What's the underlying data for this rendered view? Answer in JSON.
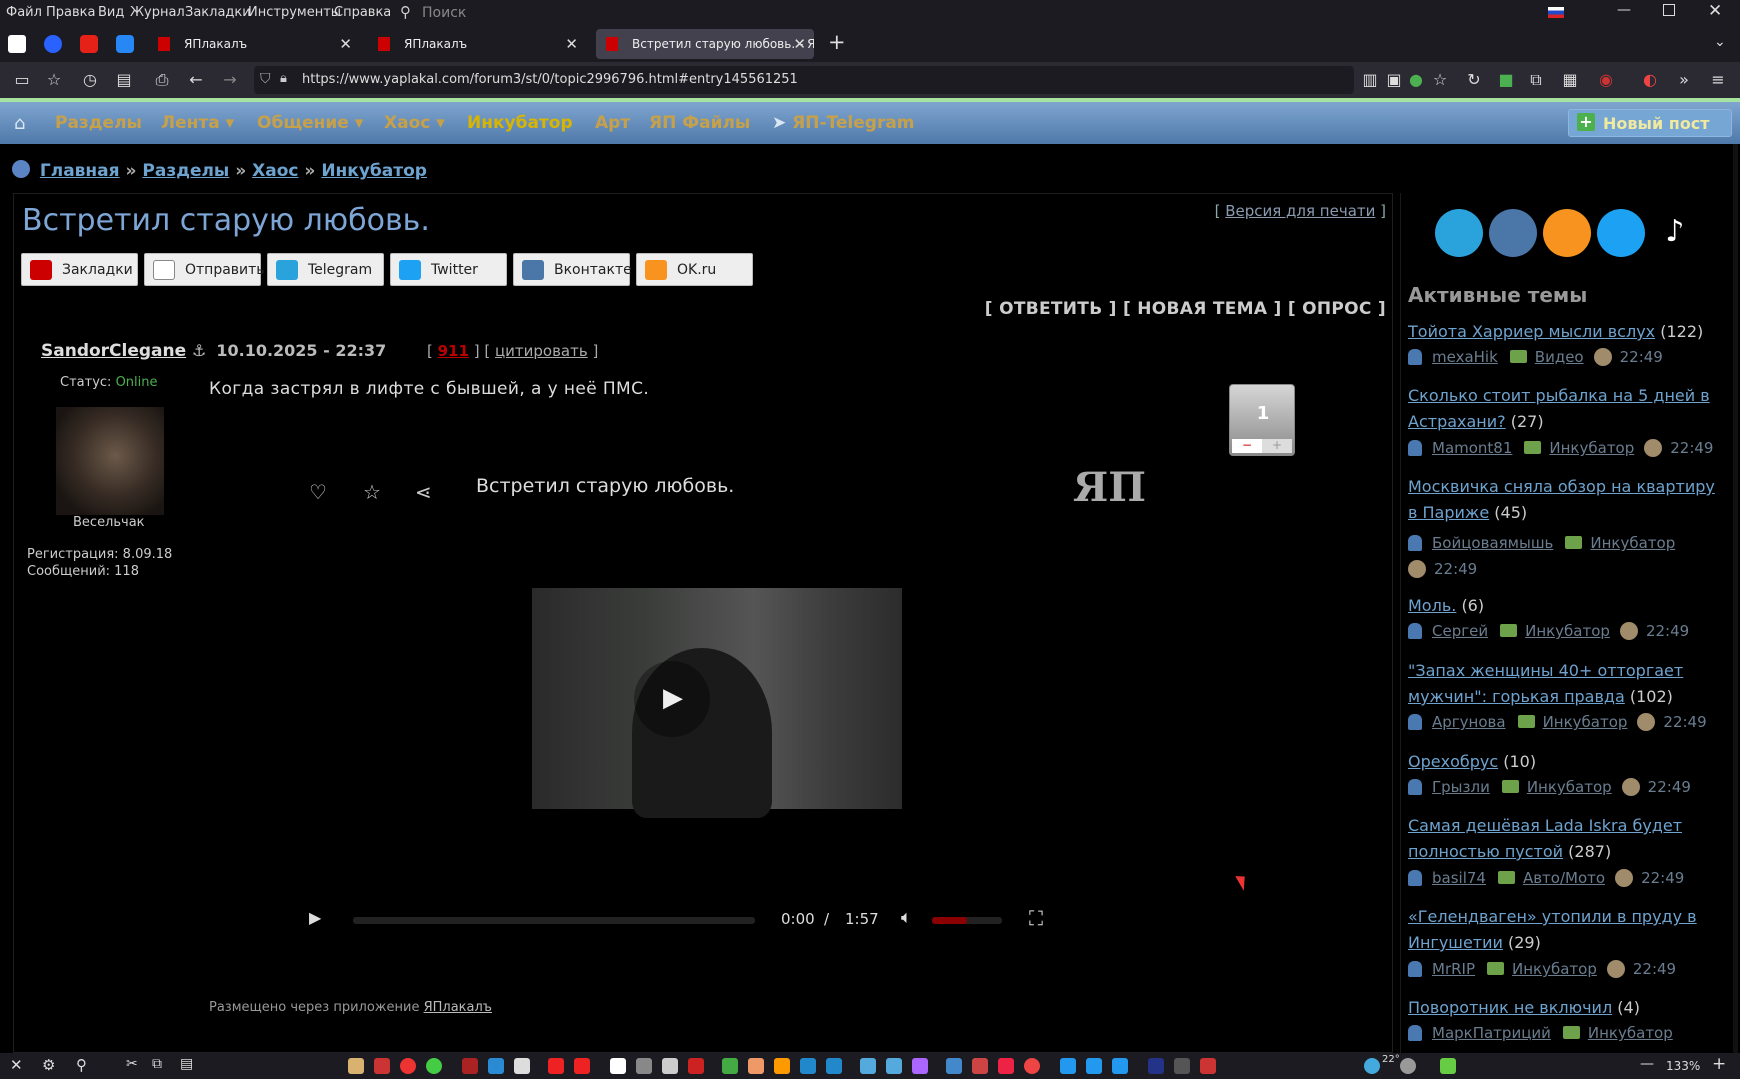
{
  "menubar": {
    "items": [
      "Файл",
      "Правка",
      "Вид",
      "Журнал",
      "Закладки",
      "Инструменты",
      "Справка"
    ],
    "search_placeholder": "Поиск"
  },
  "tabs": [
    {
      "label": "ЯПлакалъ"
    },
    {
      "label": "ЯПлакалъ"
    },
    {
      "label": "Встретил старую любовь. - ЯП"
    }
  ],
  "url": "https://www.yaplakal.com/forum3/st/0/topic2996796.html#entry145561251",
  "sitenav": {
    "items": [
      "Разделы",
      "Лента",
      "Общение",
      "Хаос",
      "Инкубатор",
      "Арт",
      "ЯП Файлы",
      "ЯП-Telegram"
    ],
    "new_post": "Новый пост"
  },
  "breadcrumb": {
    "items": [
      "Главная",
      "Разделы",
      "Хаос",
      "Инкубатор"
    ],
    "sep": "»"
  },
  "topic": {
    "title": "Встретил старую любовь.",
    "print_version": "Версия для печати",
    "share": [
      "Закладки",
      "Отправить",
      "Telegram",
      "Twitter",
      "Вконтакте",
      "OK.ru"
    ],
    "actions": "[ ОТВЕТИТЬ ] [ НОВАЯ ТЕМА ] [ ОПРОС ]"
  },
  "post": {
    "author": "SandorClegane",
    "status_label": "Статус:",
    "status_value": "Online",
    "rank": "Весельчак",
    "registration": "Регистрация: 8.09.18",
    "messages": "Сообщений: 118",
    "date": "10.10.2025 - 22:37",
    "number": "911",
    "quote": "цитировать",
    "text": "Когда застрял в лифте с бывшей, а у неё ПМС.",
    "rating": "1",
    "video_title": "Встретил старую любовь.",
    "video_logo": "ЯП",
    "time_current": "0:00",
    "time_sep": "/",
    "time_total": "1:57",
    "footnote_text": "Размещено через приложение",
    "footnote_app": "ЯПлакалъ"
  },
  "active": {
    "heading": "Активные темы",
    "topics": [
      {
        "title": "Тойота Харриер мысли вслух",
        "count": "(122)",
        "user": "mexaHik",
        "forum": "Видео",
        "time": "22:49"
      },
      {
        "title": "Сколько стоит рыбалка на 5 дней в Астрахани?",
        "count": "(27)",
        "user": "Mamont81",
        "forum": "Инкубатор",
        "time": "22:49"
      },
      {
        "title": "Москвичка сняла обзор на квартиру в Париже",
        "count": "(45)",
        "user": "Бойцоваямышь",
        "forum": "Инкубатор",
        "time": "22:49"
      },
      {
        "title": "Моль.",
        "count": "(6)",
        "user": "Сергей",
        "forum": "Инкубатор",
        "time": "22:49"
      },
      {
        "title": "\"Запах женщины 40+ отторгает мужчин\": горькая правда",
        "count": "(102)",
        "user": "Аргунова",
        "forum": "Инкубатор",
        "time": "22:49"
      },
      {
        "title": "Орехобрус",
        "count": "(10)",
        "user": "Грызли",
        "forum": "Инкубатор",
        "time": "22:49"
      },
      {
        "title": "Самая дешёвая Lada Iskra будет полностью пустой",
        "count": "(287)",
        "user": "basil74",
        "forum": "Авто/Мото",
        "time": "22:49"
      },
      {
        "title": "«Гелендваген» утопили в пруду в Ингушетии",
        "count": "(29)",
        "user": "MrRIP",
        "forum": "Инкубатор",
        "time": "22:49"
      },
      {
        "title": "Поворотник не включил",
        "count": "(4)",
        "user": "МаркПатриций",
        "forum": "Инкубатор",
        "time": ""
      }
    ]
  },
  "taskbar": {
    "weather": "22°",
    "zoom": "133%"
  }
}
